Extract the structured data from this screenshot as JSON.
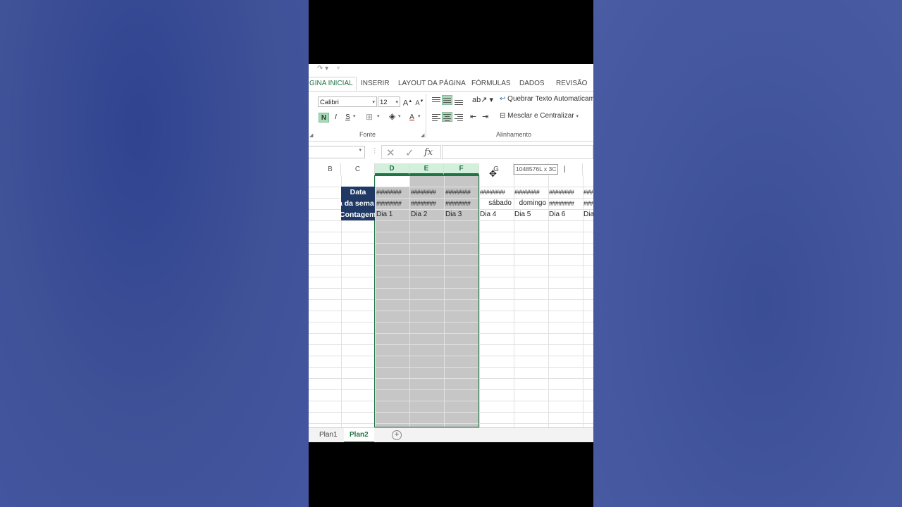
{
  "qat": {
    "redo_icon": "redo-icon",
    "customize_icon": "customize-qat-icon"
  },
  "tabs": [
    {
      "label": "GINA INICIAL",
      "active": true
    },
    {
      "label": "INSERIR"
    },
    {
      "label": "LAYOUT DA PÁGINA"
    },
    {
      "label": "FÓRMULAS"
    },
    {
      "label": "DADOS"
    },
    {
      "label": "REVISÃO"
    }
  ],
  "ribbon": {
    "font_name": "Calibri",
    "font_size": "12",
    "grow_font": "A",
    "shrink_font": "A",
    "bold": "N",
    "italic": "I",
    "underline": "S",
    "font_color": "A",
    "font_group": "Fonte",
    "wrap_text": "Quebrar Texto Automaticame",
    "merge_center": "Mesclar e Centralizar",
    "align_group": "Alinhamento"
  },
  "formula": {
    "fx": "fx",
    "value": ""
  },
  "columns": [
    {
      "label": "B"
    },
    {
      "label": "C"
    },
    {
      "label": "D",
      "selected": true
    },
    {
      "label": "E",
      "selected": true
    },
    {
      "label": "F",
      "selected": true
    },
    {
      "label": "G"
    }
  ],
  "tooltip": "1048576L x 3C",
  "rows": {
    "labels": [
      "Data",
      "a da sema",
      "Contagem"
    ],
    "data_row": [
      "########",
      "########",
      "########",
      "########",
      "########",
      "########",
      "###"
    ],
    "weekday_row": [
      "########",
      "########",
      "########",
      "sábado",
      "domingo",
      "########",
      "###"
    ],
    "count_row": [
      "Dia 1",
      "Dia 2",
      "Dia 3",
      "Dia 4",
      "Dia 5",
      "Dia 6",
      "Dia"
    ]
  },
  "sheets": [
    {
      "label": "Plan1"
    },
    {
      "label": "Plan2",
      "active": true
    }
  ],
  "colors": {
    "accent": "#217346",
    "header_fill": "#1f3864",
    "selection": "#c6c6c6",
    "background": "#3f5197"
  }
}
